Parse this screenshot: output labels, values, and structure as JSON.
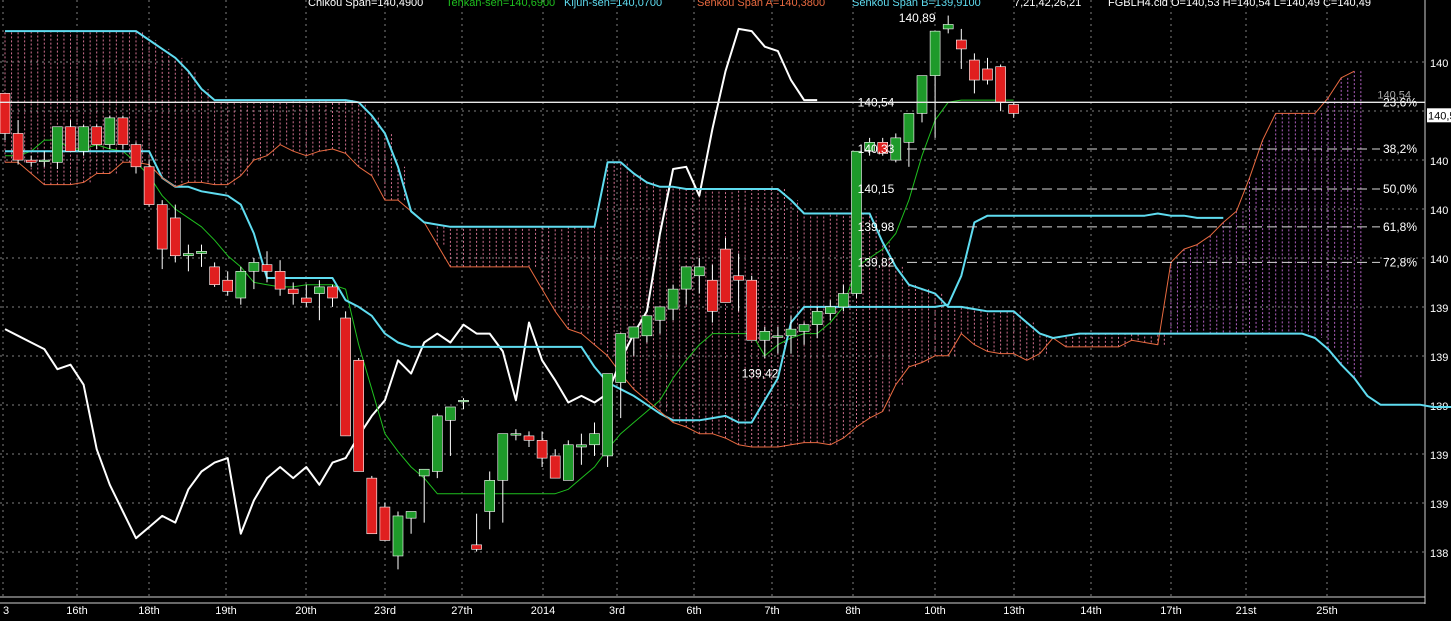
{
  "header": {
    "chikou": "Chikou Span=140,4900",
    "tenkan": "Tenkan-sen=140,6900",
    "kijun": "Kijun-sen=140,0700",
    "senkou_a": "Senkou Span A=140,3800",
    "senkou_b": "Senkou Span B=139,9100",
    "params": "7,21,42,26,21",
    "ohlc": "FGBLH4.cld O=140,53 H=140,54 L=140,49 C=140,49"
  },
  "colors": {
    "background": "#000000",
    "grid": "#7f7f7f",
    "bull": "#1e9a2a",
    "bear": "#e01f1f",
    "tenkan": "#1fbf1f",
    "kijun": "#5fdcf0",
    "senkou_a": "#e86a40",
    "senkou_b": "#5fdcf0",
    "chikou": "#ffffff",
    "cloud_bull": "#b060c0",
    "cloud_bear": "#d07090",
    "fib": "#d8d8d8",
    "label": "#ffffff"
  },
  "chart_data": {
    "type": "candlestick",
    "x_tick_labels": [
      "3",
      "16th",
      "18th",
      "19th",
      "20th",
      "23rd",
      "27th",
      "2014",
      "3rd",
      "6th",
      "7th",
      "8th",
      "10th",
      "13th",
      "14th",
      "17th",
      "21st",
      "25th"
    ],
    "y_tick_labels": [
      "140",
      "140",
      "140",
      "140",
      "140",
      "139",
      "139",
      "139",
      "139",
      "139",
      "138"
    ],
    "ylim": [
      138.32,
      141.0
    ],
    "grid": true,
    "current_price_label": "140,5",
    "price_line": {
      "value": 140.54,
      "label": "140,54"
    },
    "fibonacci": [
      {
        "value": 140.54,
        "label": "140,54",
        "pct": "23,6%"
      },
      {
        "value": 140.33,
        "label": "140,33",
        "pct": "38,2%"
      },
      {
        "value": 140.15,
        "label": "140,15",
        "pct": "50,0%"
      },
      {
        "value": 139.98,
        "label": "139,98",
        "pct": "61,8%"
      },
      {
        "value": 139.82,
        "label": "139,82",
        "pct": "72,8%"
      }
    ],
    "annotations": [
      {
        "bar": 68,
        "value": 140.92,
        "label": "140,89"
      },
      {
        "bar": 56,
        "value": 139.32,
        "label": "139,42"
      }
    ],
    "candles": [
      [
        140.58,
        140.58,
        140.37,
        140.4
      ],
      [
        140.4,
        140.46,
        140.26,
        140.28
      ],
      [
        140.28,
        140.3,
        140.25,
        140.27
      ],
      [
        140.28,
        140.32,
        140.25,
        140.28
      ],
      [
        140.27,
        140.43,
        140.24,
        140.43
      ],
      [
        140.43,
        140.46,
        140.32,
        140.32
      ],
      [
        140.32,
        140.44,
        140.3,
        140.43
      ],
      [
        140.43,
        140.44,
        140.33,
        140.35
      ],
      [
        140.35,
        140.48,
        140.33,
        140.47
      ],
      [
        140.47,
        140.48,
        140.33,
        140.35
      ],
      [
        140.35,
        140.36,
        140.22,
        140.25
      ],
      [
        140.25,
        140.28,
        140.07,
        140.08
      ],
      [
        140.08,
        140.1,
        139.79,
        139.88
      ],
      [
        140.02,
        140.08,
        139.82,
        139.85
      ],
      [
        139.85,
        139.9,
        139.78,
        139.86
      ],
      [
        139.86,
        139.9,
        139.8,
        139.87
      ],
      [
        139.8,
        139.82,
        139.71,
        139.72
      ],
      [
        139.74,
        139.78,
        139.67,
        139.69
      ],
      [
        139.66,
        139.8,
        139.63,
        139.78
      ],
      [
        139.78,
        139.84,
        139.7,
        139.82
      ],
      [
        139.81,
        139.87,
        139.73,
        139.78
      ],
      [
        139.78,
        139.83,
        139.67,
        139.7
      ],
      [
        139.7,
        139.73,
        139.63,
        139.68
      ],
      [
        139.66,
        139.72,
        139.62,
        139.64
      ],
      [
        139.68,
        139.74,
        139.56,
        139.71
      ],
      [
        139.71,
        139.72,
        139.62,
        139.66
      ],
      [
        139.57,
        139.6,
        139.04,
        139.04
      ],
      [
        139.38,
        139.39,
        138.88,
        138.88
      ],
      [
        138.85,
        138.86,
        138.61,
        138.6
      ],
      [
        138.72,
        138.74,
        138.6,
        138.57
      ],
      [
        138.5,
        138.7,
        138.44,
        138.68
      ],
      [
        138.67,
        138.7,
        138.6,
        138.7
      ],
      [
        138.86,
        138.89,
        138.65,
        138.89
      ],
      [
        138.88,
        139.14,
        138.85,
        139.13
      ],
      [
        139.11,
        139.17,
        138.95,
        139.17
      ],
      [
        139.2,
        139.21,
        139.16,
        139.2
      ],
      [
        138.55,
        138.69,
        138.52,
        138.53
      ],
      [
        138.7,
        138.88,
        138.62,
        138.84
      ],
      [
        138.84,
        139.03,
        138.65,
        139.05
      ],
      [
        139.05,
        139.07,
        139.02,
        139.05
      ],
      [
        139.04,
        139.06,
        138.99,
        139.02
      ],
      [
        139.02,
        139.06,
        138.9,
        138.94
      ],
      [
        138.95,
        138.98,
        138.85,
        138.85
      ],
      [
        138.84,
        139.02,
        138.86,
        139.0
      ],
      [
        138.99,
        139.05,
        138.91,
        139.0
      ],
      [
        139.0,
        139.1,
        138.95,
        139.05
      ],
      [
        138.95,
        139.3,
        138.9,
        139.32
      ],
      [
        139.28,
        139.5,
        139.12,
        139.5
      ],
      [
        139.48,
        139.53,
        139.4,
        139.53
      ],
      [
        139.49,
        139.55,
        139.46,
        139.58
      ],
      [
        139.56,
        139.61,
        139.5,
        139.62
      ],
      [
        139.61,
        139.72,
        139.56,
        139.7
      ],
      [
        139.7,
        139.8,
        139.63,
        139.8
      ],
      [
        139.76,
        139.84,
        139.68,
        139.8
      ],
      [
        139.74,
        139.81,
        139.55,
        139.6
      ],
      [
        139.88,
        139.93,
        139.64,
        139.64
      ],
      [
        139.76,
        139.86,
        139.6,
        139.74
      ],
      [
        139.74,
        139.76,
        139.47,
        139.47
      ],
      [
        139.47,
        139.53,
        139.39,
        139.51
      ],
      [
        139.49,
        139.53,
        139.41,
        139.49
      ],
      [
        139.49,
        139.58,
        139.41,
        139.52
      ],
      [
        139.51,
        139.55,
        139.45,
        139.54
      ],
      [
        139.54,
        139.62,
        139.48,
        139.6
      ],
      [
        139.59,
        139.65,
        139.56,
        139.62
      ],
      [
        139.62,
        139.72,
        139.6,
        139.68
      ],
      [
        139.68,
        140.01,
        139.66,
        140.32
      ],
      [
        140.32,
        140.38,
        140.3,
        140.36
      ],
      [
        140.36,
        140.38,
        140.3,
        140.31
      ],
      [
        140.28,
        140.4,
        140.27,
        140.38
      ],
      [
        140.36,
        140.49,
        140.25,
        140.49
      ],
      [
        140.49,
        140.59,
        140.45,
        140.66
      ],
      [
        140.66,
        140.72,
        140.38,
        140.86
      ],
      [
        140.87,
        140.93,
        140.85,
        140.89
      ],
      [
        140.82,
        140.87,
        140.69,
        140.78
      ],
      [
        140.73,
        140.76,
        140.58,
        140.64
      ],
      [
        140.69,
        140.74,
        140.62,
        140.64
      ],
      [
        140.7,
        140.71,
        140.5,
        140.54
      ],
      [
        140.53,
        140.54,
        140.47,
        140.49
      ]
    ],
    "series": [
      {
        "name": "Chikou Span",
        "bar_start": 0,
        "values": [
          139.52,
          139.49,
          139.46,
          139.43,
          139.34,
          139.36,
          139.27,
          138.98,
          138.82,
          138.7,
          138.58,
          138.63,
          138.68,
          138.65,
          138.8,
          138.88,
          138.92,
          138.94,
          138.6,
          138.75,
          138.85,
          138.9,
          138.85,
          138.9,
          138.82,
          138.92,
          138.94,
          139.04,
          139.13,
          139.2,
          139.38,
          139.32,
          139.46,
          139.5,
          139.46,
          139.54,
          139.5,
          139.5,
          139.42,
          139.2,
          139.55,
          139.38,
          139.29,
          139.19,
          139.22,
          139.19,
          139.23,
          139.38,
          139.5,
          139.6,
          139.95,
          140.24,
          140.25,
          140.12,
          140.42,
          140.68,
          140.87,
          140.86,
          140.79,
          140.77,
          140.64,
          140.55,
          140.55
        ]
      },
      {
        "name": "Tenkan-sen",
        "bar_start": 0,
        "values": [
          140.3,
          140.3,
          140.32,
          140.37,
          140.37,
          140.33,
          140.33,
          140.35,
          140.33,
          140.32,
          140.27,
          140.21,
          140.12,
          140.06,
          140.02,
          139.98,
          139.92,
          139.85,
          139.8,
          139.73,
          139.72,
          139.71,
          139.71,
          139.72,
          139.72,
          139.72,
          139.7,
          139.45,
          139.25,
          139.05,
          138.97,
          138.9,
          138.85,
          138.78,
          138.78,
          138.78,
          138.78,
          138.78,
          138.78,
          138.78,
          138.78,
          138.78,
          138.78,
          138.8,
          138.85,
          138.9,
          138.98,
          139.05,
          139.1,
          139.15,
          139.2,
          139.3,
          139.38,
          139.45,
          139.5,
          139.5,
          139.5,
          139.5,
          139.4,
          139.45,
          139.48,
          139.5,
          139.5,
          139.55,
          139.62,
          139.8,
          139.84,
          139.88,
          139.95,
          140.1,
          140.3,
          140.46,
          140.54,
          140.55,
          140.55,
          140.55,
          140.55,
          140.55
        ]
      },
      {
        "name": "Kijun-sen",
        "bar_start": 0,
        "values": [
          140.32,
          140.32,
          140.32,
          140.32,
          140.32,
          140.32,
          140.32,
          140.32,
          140.32,
          140.32,
          140.32,
          140.32,
          140.2,
          140.16,
          140.16,
          140.14,
          140.13,
          140.12,
          140.08,
          139.95,
          139.75,
          139.75,
          139.75,
          139.75,
          139.75,
          139.75,
          139.65,
          139.62,
          139.58,
          139.5,
          139.46,
          139.44,
          139.44,
          139.44,
          139.44,
          139.44,
          139.44,
          139.44,
          139.44,
          139.44,
          139.44,
          139.44,
          139.44,
          139.44,
          139.44,
          139.35,
          139.28,
          139.25,
          139.22,
          139.18,
          139.14,
          139.11,
          139.11,
          139.11,
          139.12,
          139.13,
          139.1,
          139.1,
          139.2,
          139.3,
          139.55,
          139.62,
          139.62,
          139.62,
          139.62,
          139.62,
          139.62,
          139.62,
          139.62,
          139.62,
          139.62,
          139.62,
          139.63,
          139.76,
          140.0,
          140.03,
          140.03,
          140.03,
          140.03,
          140.03,
          140.03,
          140.03,
          140.03,
          140.03,
          140.03,
          140.03,
          140.03,
          140.03,
          140.04,
          140.03,
          140.03,
          140.02,
          140.02,
          140.02
        ]
      },
      {
        "name": "Senkou Span A",
        "bar_start": 0,
        "values": [
          140.27,
          140.27,
          140.22,
          140.17,
          140.17,
          140.17,
          140.18,
          140.22,
          140.22,
          140.27,
          140.27,
          140.26,
          140.2,
          140.16,
          140.18,
          140.18,
          140.17,
          140.17,
          140.21,
          140.28,
          140.3,
          140.35,
          140.32,
          140.3,
          140.32,
          140.33,
          140.31,
          140.25,
          140.21,
          140.1,
          140.1,
          140.05,
          140.0,
          139.9,
          139.8,
          139.8,
          139.8,
          139.8,
          139.8,
          139.8,
          139.8,
          139.7,
          139.6,
          139.52,
          139.5,
          139.45,
          139.4,
          139.32,
          139.25,
          139.2,
          139.15,
          139.1,
          139.08,
          139.05,
          139.05,
          139.03,
          139.0,
          138.99,
          138.99,
          138.99,
          139.0,
          139.01,
          139.01,
          139.0,
          139.03,
          139.08,
          139.12,
          139.15,
          139.27,
          139.35,
          139.37,
          139.4,
          139.4,
          139.5,
          139.45,
          139.42,
          139.41,
          139.41,
          139.38,
          139.41,
          139.48,
          139.44,
          139.44,
          139.44,
          139.44,
          139.44,
          139.47,
          139.46,
          139.45,
          139.82,
          139.88,
          139.9,
          139.94,
          140.0,
          140.05,
          140.2,
          140.37,
          140.49,
          140.49,
          140.49,
          140.49,
          140.56,
          140.65,
          140.68
        ]
      },
      {
        "name": "Senkou Span B",
        "bar_start": 0,
        "values": [
          140.86,
          140.86,
          140.86,
          140.86,
          140.86,
          140.86,
          140.86,
          140.86,
          140.86,
          140.86,
          140.86,
          140.82,
          140.78,
          140.74,
          140.68,
          140.6,
          140.55,
          140.55,
          140.55,
          140.55,
          140.55,
          140.55,
          140.55,
          140.55,
          140.55,
          140.55,
          140.55,
          140.54,
          140.48,
          140.4,
          140.25,
          140.05,
          140.0,
          139.99,
          139.98,
          139.98,
          139.98,
          139.98,
          139.98,
          139.98,
          139.98,
          139.98,
          139.98,
          139.98,
          139.98,
          139.98,
          140.27,
          140.27,
          140.22,
          140.18,
          140.16,
          140.16,
          140.15,
          140.15,
          140.15,
          140.15,
          140.15,
          140.15,
          140.15,
          140.15,
          140.1,
          140.04,
          140.04,
          140.04,
          140.04,
          140.04,
          140.04,
          139.91,
          139.8,
          139.72,
          139.7,
          139.68,
          139.62,
          139.62,
          139.61,
          139.6,
          139.6,
          139.6,
          139.55,
          139.5,
          139.48,
          139.49,
          139.5,
          139.5,
          139.5,
          139.5,
          139.5,
          139.5,
          139.5,
          139.5,
          139.5,
          139.5,
          139.5,
          139.5,
          139.5,
          139.5,
          139.5,
          139.5,
          139.5,
          139.5,
          139.48,
          139.43,
          139.36,
          139.3,
          139.22,
          139.18,
          139.18,
          139.18,
          139.18,
          139.17,
          139.17,
          139.17,
          139.17,
          139.18,
          139.18,
          139.18,
          139.18,
          139.18,
          139.18,
          139.15,
          139.15,
          139.15,
          139.15,
          139.15,
          139.3,
          139.3,
          139.3,
          139.3,
          139.36,
          139.45,
          139.54,
          139.59,
          139.59,
          139.59,
          139.59,
          139.6,
          139.7,
          139.7
        ]
      }
    ]
  }
}
